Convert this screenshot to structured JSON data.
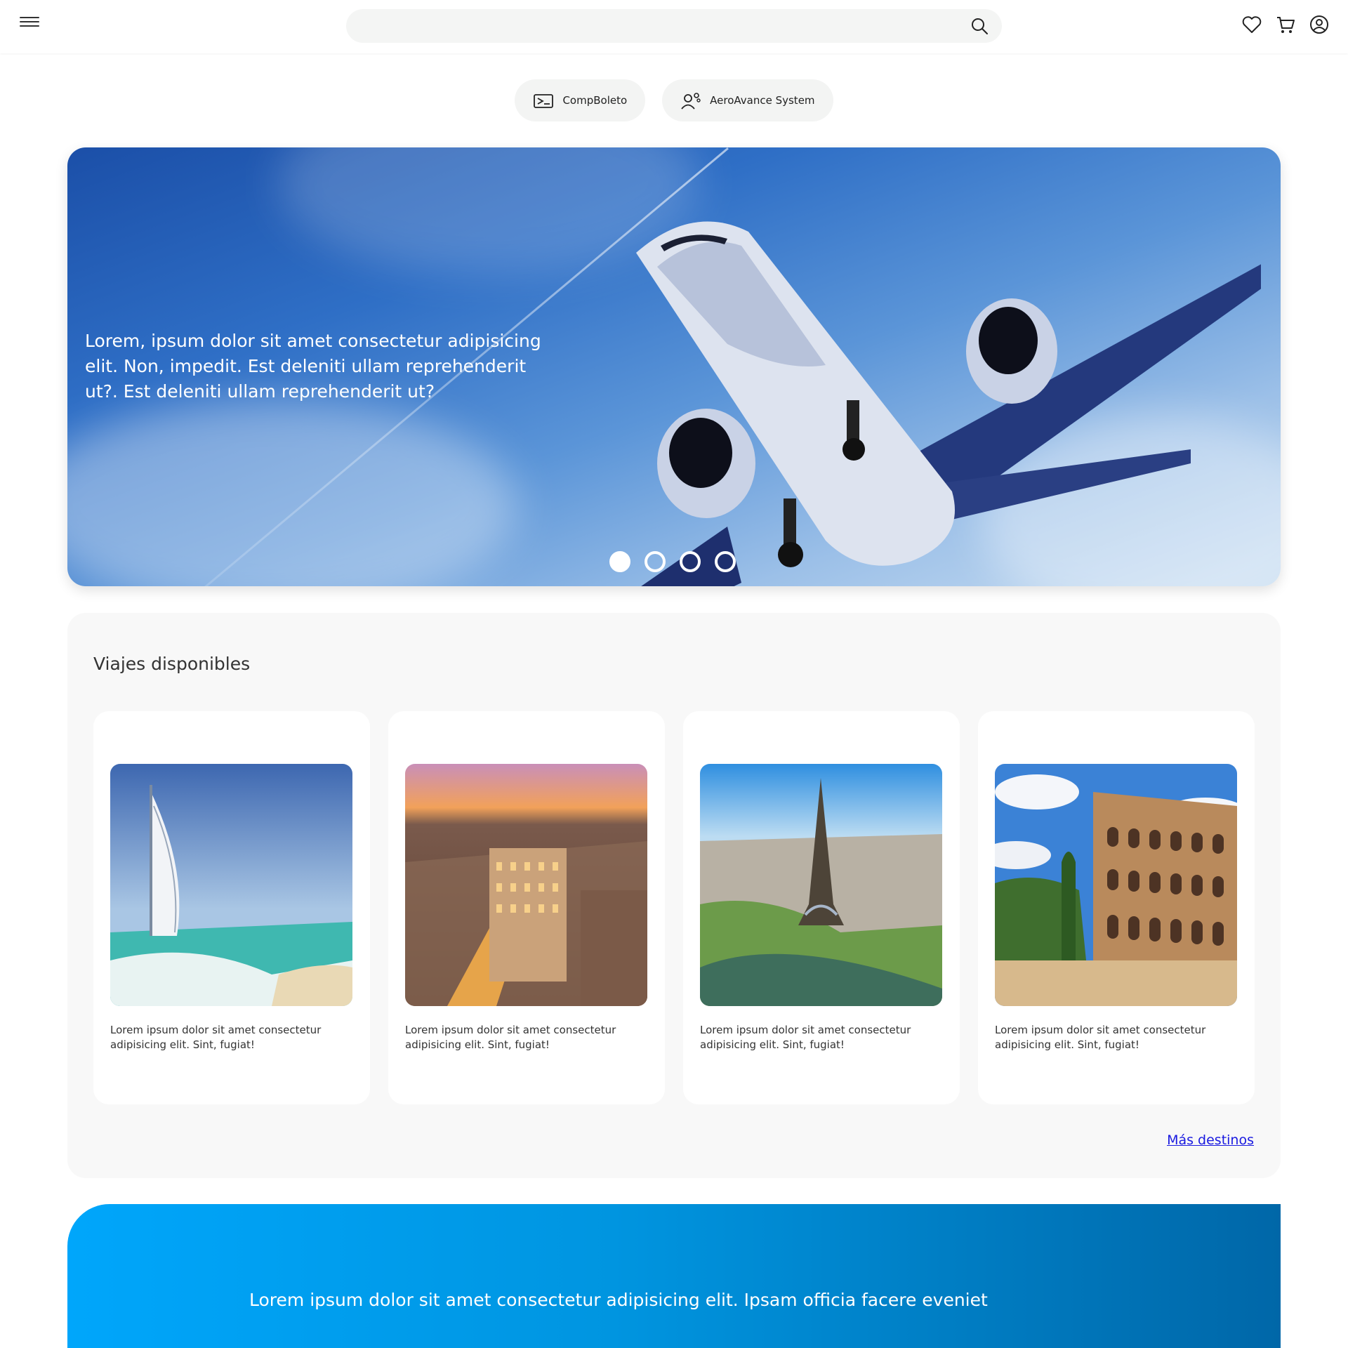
{
  "header": {
    "search_placeholder": "",
    "icons": [
      "menu-icon",
      "search-icon",
      "heart-icon",
      "cart-icon",
      "user-icon"
    ]
  },
  "chips": [
    {
      "label": "CompBoleto",
      "icon": "ticket-icon"
    },
    {
      "label": "AeroAvance System",
      "icon": "agent-gear-icon"
    }
  ],
  "hero": {
    "text": "Lorem, ipsum dolor sit amet consectetur adipisicing elit. Non, impedit. Est deleniti ullam reprehenderit ut?. Est deleniti ullam reprehenderit ut?",
    "slide_count": 4,
    "active_slide": 1
  },
  "trips": {
    "title": "Viajes disponibles",
    "cards": [
      {
        "text": "Lorem ipsum dolor sit amet consectetur adipisicing elit. Sint, fugiat!"
      },
      {
        "text": "Lorem ipsum dolor sit amet consectetur adipisicing elit. Sint, fugiat!"
      },
      {
        "text": "Lorem ipsum dolor sit amet consectetur adipisicing elit. Sint, fugiat!"
      },
      {
        "text": "Lorem ipsum dolor sit amet consectetur adipisicing elit. Sint, fugiat!"
      }
    ],
    "more_link": "Más destinos"
  },
  "banner": {
    "text": "Lorem ipsum dolor sit amet consectetur adipisicing elit. Ipsam officia facere eveniet"
  },
  "colors": {
    "link": "#1a1ae0",
    "banner_start": "#00a6fb",
    "banner_end": "#0067a8",
    "chip_bg": "#f3f4f3"
  }
}
